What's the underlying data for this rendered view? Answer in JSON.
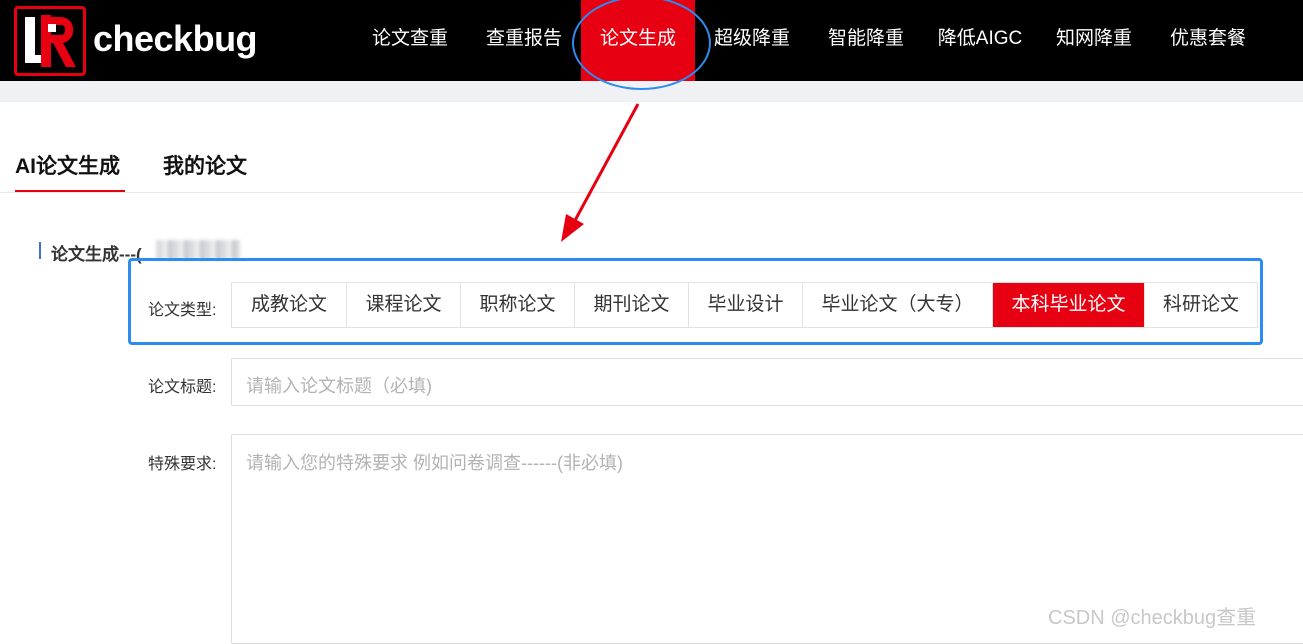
{
  "header": {
    "brand": "checkbug",
    "nav": [
      {
        "label": "论文查重"
      },
      {
        "label": "查重报告"
      },
      {
        "label": "论文生成",
        "active": true
      },
      {
        "label": "超级降重"
      },
      {
        "label": "智能降重"
      },
      {
        "label": "降低AIGC"
      },
      {
        "label": "知网降重"
      },
      {
        "label": "优惠套餐"
      }
    ]
  },
  "tabs": [
    {
      "label": "AI论文生成",
      "active": true
    },
    {
      "label": "我的论文"
    }
  ],
  "section": {
    "title": "论文生成---("
  },
  "form": {
    "type_label": "论文类型:",
    "types": [
      {
        "label": "成教论文"
      },
      {
        "label": "课程论文"
      },
      {
        "label": "职称论文"
      },
      {
        "label": "期刊论文"
      },
      {
        "label": "毕业设计"
      },
      {
        "label": "毕业论文（大专）"
      },
      {
        "label": "本科毕业论文",
        "selected": true
      },
      {
        "label": "科研论文"
      }
    ],
    "title_label": "论文标题:",
    "title_placeholder": "请输入论文标题（必填)",
    "req_label": "特殊要求:",
    "req_placeholder": "请输入您的特殊要求 例如问卷调查------(非必填)"
  },
  "watermark": "CSDN @checkbug查重",
  "colors": {
    "brand_red": "#e60012",
    "annotation_blue": "#2d8cf0",
    "header_bg": "#000000"
  }
}
